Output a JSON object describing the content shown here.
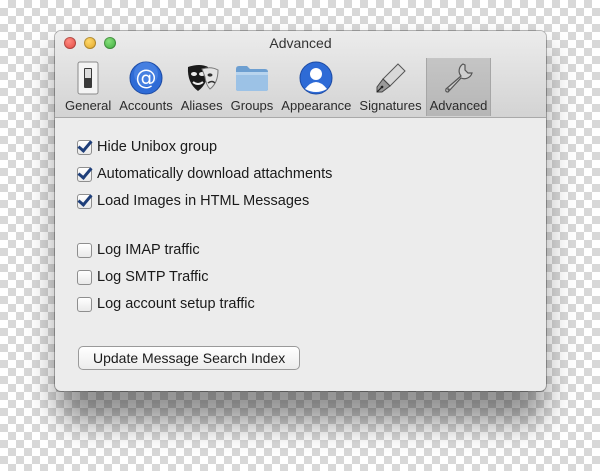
{
  "window": {
    "title": "Advanced"
  },
  "toolbar": {
    "tabs": [
      {
        "label": "General",
        "icon": "light-switch-icon"
      },
      {
        "label": "Accounts",
        "icon": "at-sign-icon"
      },
      {
        "label": "Aliases",
        "icon": "masks-icon"
      },
      {
        "label": "Groups",
        "icon": "folder-icon"
      },
      {
        "label": "Appearance",
        "icon": "person-icon"
      },
      {
        "label": "Signatures",
        "icon": "fountain-pen-icon"
      },
      {
        "label": "Advanced",
        "icon": "wrench-icon",
        "selected": true
      }
    ]
  },
  "options": {
    "group1": [
      {
        "label": "Hide Unibox group",
        "checked": true
      },
      {
        "label": "Automatically download attachments",
        "checked": true
      },
      {
        "label": "Load Images in HTML Messages",
        "checked": true
      }
    ],
    "group2": [
      {
        "label": "Log IMAP traffic",
        "checked": false
      },
      {
        "label": "Log SMTP Traffic",
        "checked": false
      },
      {
        "label": "Log account setup traffic",
        "checked": false
      }
    ]
  },
  "actions": {
    "update_index_label": "Update Message Search Index"
  },
  "colors": {
    "accent": "#2e6bd6",
    "checkmark": "#1f3f7a",
    "window_bg": "#ececec"
  }
}
